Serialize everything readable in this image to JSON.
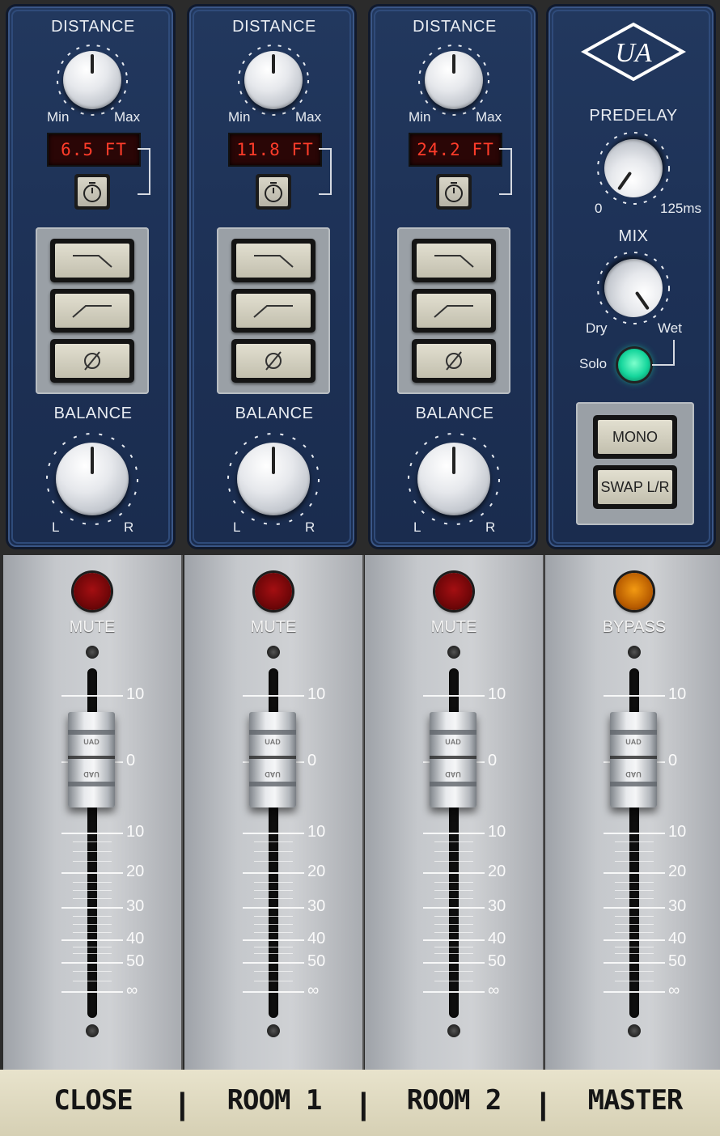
{
  "channels": [
    {
      "distance_label": "DISTANCE",
      "min": "Min",
      "max": "Max",
      "readout": "6.5 FT",
      "balance_label": "BALANCE",
      "bal_l": "L",
      "bal_r": "R",
      "mute": "MUTE",
      "name": "CLOSE"
    },
    {
      "distance_label": "DISTANCE",
      "min": "Min",
      "max": "Max",
      "readout": "11.8 FT",
      "balance_label": "BALANCE",
      "bal_l": "L",
      "bal_r": "R",
      "mute": "MUTE",
      "name": "ROOM 1"
    },
    {
      "distance_label": "DISTANCE",
      "min": "Min",
      "max": "Max",
      "readout": "24.2 FT",
      "balance_label": "BALANCE",
      "bal_l": "L",
      "bal_r": "R",
      "mute": "MUTE",
      "name": "ROOM 2"
    }
  ],
  "master": {
    "predelay_label": "PREDELAY",
    "predelay_min": "0",
    "predelay_max": "125ms",
    "mix_label": "MIX",
    "mix_min": "Dry",
    "mix_max": "Wet",
    "solo_label": "Solo",
    "mono_label": "MONO",
    "swap_label": "SWAP L/R",
    "bypass": "BYPASS",
    "name": "MASTER"
  },
  "fader_scale": [
    "10",
    "0",
    "10",
    "20",
    "30",
    "40",
    "50",
    "∞"
  ],
  "fader_cap_badge": "UAD",
  "logo_text": "UA",
  "icons": [
    "timer-icon",
    "low-cut-icon",
    "high-cut-icon",
    "phase-invert-icon"
  ],
  "colors": {
    "panel": "#1d3156",
    "readout_text": "#ff3c2a",
    "mute_lamp": "#8e0c0e",
    "bypass_lamp": "#e07d0a",
    "solo_led": "#15d69c",
    "footer": "#e3ddc3"
  }
}
